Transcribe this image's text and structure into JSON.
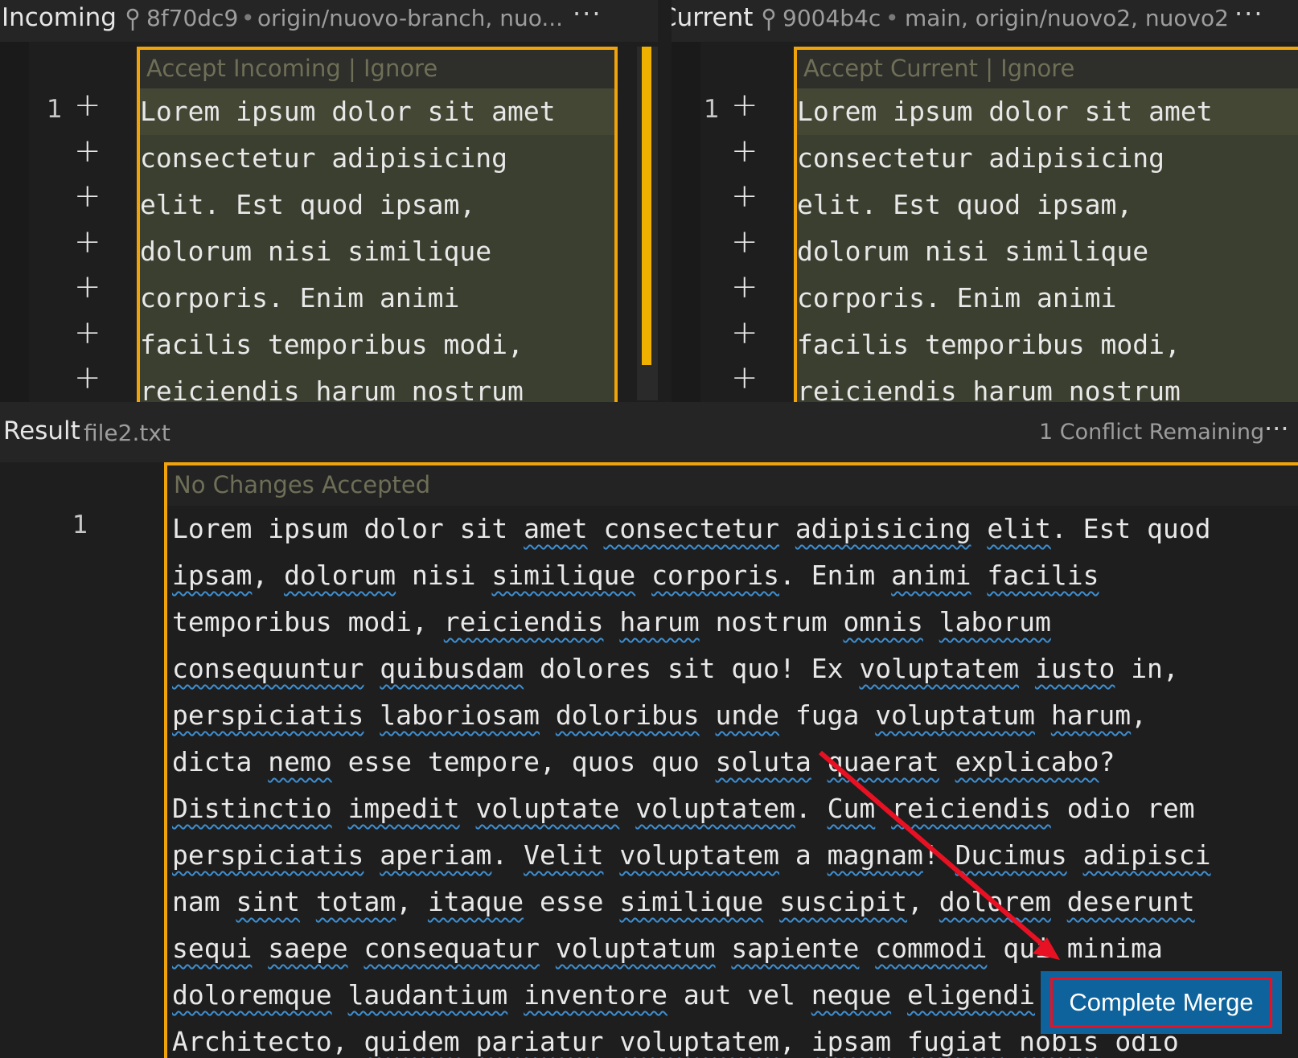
{
  "incoming": {
    "title": "Incoming",
    "commit": "8f70dc9",
    "separator": "•",
    "branches": "origin/nuovo-branch, nuo...",
    "more": "···",
    "codelens": "Accept Incoming | Ignore",
    "line_number": "1",
    "lines": [
      "Lorem ipsum dolor sit amet",
      "consectetur adipisicing",
      "elit. Est quod ipsam,",
      "dolorum nisi similique",
      "corporis. Enim animi",
      "facilis temporibus modi,",
      "reiciendis harum nostrum"
    ]
  },
  "current": {
    "title": "Current",
    "commit": "9004b4c",
    "separator": "•",
    "branches": "main, origin/nuovo2, nuovo2",
    "more": "···",
    "codelens": "Accept Current | Ignore",
    "line_number": "1",
    "lines": [
      "Lorem ipsum dolor sit amet",
      "consectetur adipisicing",
      "elit. Est quod ipsam,",
      "dolorum nisi similique",
      "corporis. Enim animi",
      "facilis temporibus modi,",
      "reiciendis harum nostrum"
    ]
  },
  "gutter_symbol": "+",
  "result": {
    "title": "Result",
    "file": "file2.txt",
    "remaining": "1 Conflict Remaining",
    "more": "···",
    "codelens": "No Changes Accepted",
    "line_number": "1",
    "lines": [
      "Lorem ipsum dolor sit amet consectetur adipisicing elit. Est quod",
      "ipsam, dolorum nisi similique corporis. Enim animi facilis",
      "temporibus modi, reiciendis harum nostrum omnis laborum",
      "consequuntur quibusdam dolores sit quo! Ex voluptatem iusto in,",
      "perspiciatis laboriosam doloribus unde fuga voluptatum harum,",
      "dicta nemo esse tempore, quos quo soluta quaerat explicabo?",
      "Distinctio impedit voluptate voluptatem. Cum reiciendis odio rem",
      "perspiciatis aperiam. Velit voluptatem a magnam! Ducimus adipisci",
      "nam sint totam, itaque esse similique suscipit, dolorem deserunt",
      "sequi saepe consequatur voluptatum sapiente commodi qui minima",
      "doloremque laudantium inventore aut vel neque eligendi.",
      "Architecto, quidem pariatur voluptatem, ipsam fugiat nobis odio"
    ],
    "misspelled": [
      "amet",
      "consectetur",
      "adipisicing",
      "elit",
      "ipsam",
      "dolorum",
      "similique",
      "corporis",
      "animi",
      "facilis",
      "reiciendis",
      "harum",
      "omnis",
      "laborum",
      "consequuntur",
      "quibusdam",
      "voluptatem",
      "iusto",
      "perspiciatis",
      "laboriosam",
      "doloribus",
      "unde",
      "voluptatum",
      "nemo",
      "soluta",
      "quaerat",
      "explicabo",
      "Distinctio",
      "impedit",
      "voluptate",
      "Cum",
      "aperiam",
      "Velit",
      "magnam",
      "Ducimus",
      "adipisci",
      "sint",
      "totam",
      "itaque",
      "suscipit",
      "dolorem",
      "deserunt",
      "sequi",
      "saepe",
      "consequatur",
      "sapiente",
      "commodi",
      "doloremque",
      "laudantium",
      "inventore",
      "neque",
      "eligendi",
      "quidem",
      "pariatur",
      "fugiat",
      "nobis"
    ]
  },
  "complete_merge_button": "Complete Merge",
  "colors": {
    "conflict_border": "#f0a30a",
    "scroll_thumb": "#f0b000",
    "button_bg": "#0e639c",
    "annotation_red": "#e81123",
    "squiggle": "#3e8ed0"
  }
}
